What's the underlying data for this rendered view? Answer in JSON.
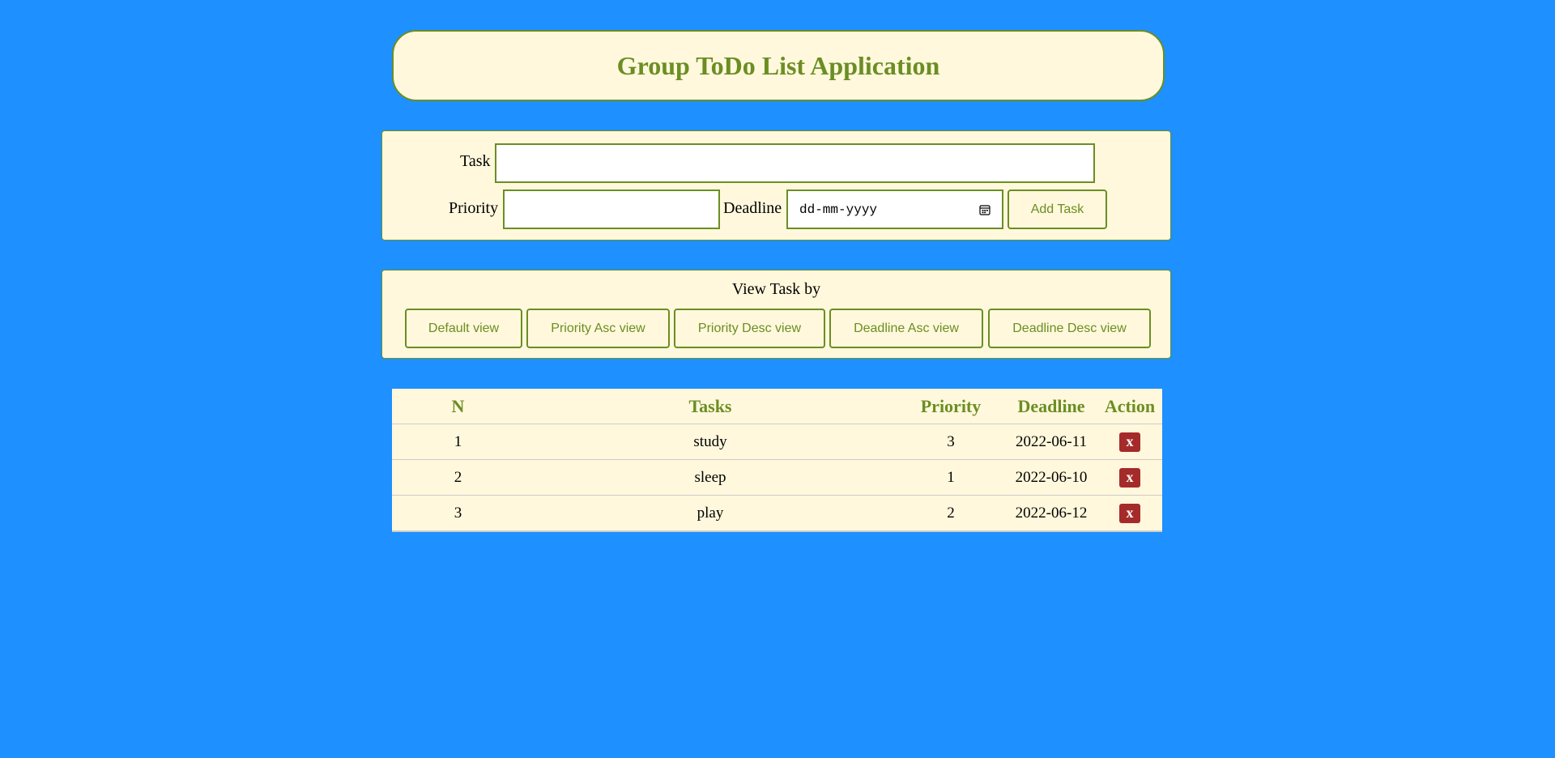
{
  "header": {
    "title": "Group ToDo List Application"
  },
  "form": {
    "task_label": "Task",
    "task_value": "",
    "priority_label": "Priority",
    "priority_value": "",
    "deadline_label": "Deadline",
    "deadline_placeholder": "dd-mm-yyyy",
    "add_button": "Add Task"
  },
  "views": {
    "title": "View Task by",
    "buttons": [
      "Default view",
      "Priority Asc view",
      "Priority Desc view",
      "Deadline Asc view",
      "Deadline Desc view"
    ]
  },
  "table": {
    "columns": [
      "N",
      "Tasks",
      "Priority",
      "Deadline",
      "Action"
    ],
    "rows": [
      {
        "n": "1",
        "task": "study",
        "priority": "3",
        "deadline": "2022-06-11",
        "action": "x"
      },
      {
        "n": "2",
        "task": "sleep",
        "priority": "1",
        "deadline": "2022-06-10",
        "action": "x"
      },
      {
        "n": "3",
        "task": "play",
        "priority": "2",
        "deadline": "2022-06-12",
        "action": "x"
      }
    ]
  },
  "colors": {
    "background": "#1e90ff",
    "panel": "#fff8dc",
    "accent": "#6b8e23",
    "delete": "#a52a2a"
  }
}
